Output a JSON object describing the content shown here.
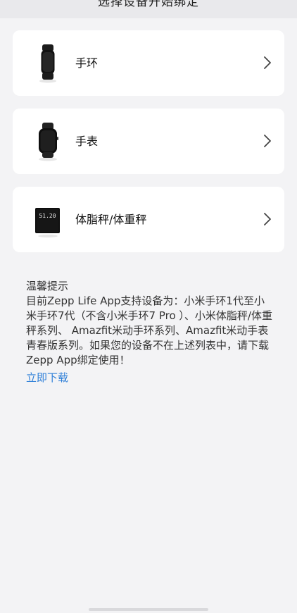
{
  "header": {
    "title": "选择设备开始绑定"
  },
  "devices": [
    {
      "label": "手环",
      "icon": "band-icon"
    },
    {
      "label": "手表",
      "icon": "watch-icon"
    },
    {
      "label": "体脂秤/体重秤",
      "icon": "scale-icon",
      "scale_display": "51.20"
    }
  ],
  "tips": {
    "title": "温馨提示",
    "body": "目前Zepp Life App支持设备为：小米手环1代至小米手环7代（不含小米手环7 Pro ）、小米体脂秤/体重秤系列、 Amazfit米动手环系列、Amazfit米动手表青春版系列。如果您的设备不在上述列表中，请下载Zepp App绑定使用！",
    "download_label": "立即下载"
  },
  "colors": {
    "background": "#f3f3f5",
    "card": "#ffffff",
    "link": "#2e7fd8"
  }
}
